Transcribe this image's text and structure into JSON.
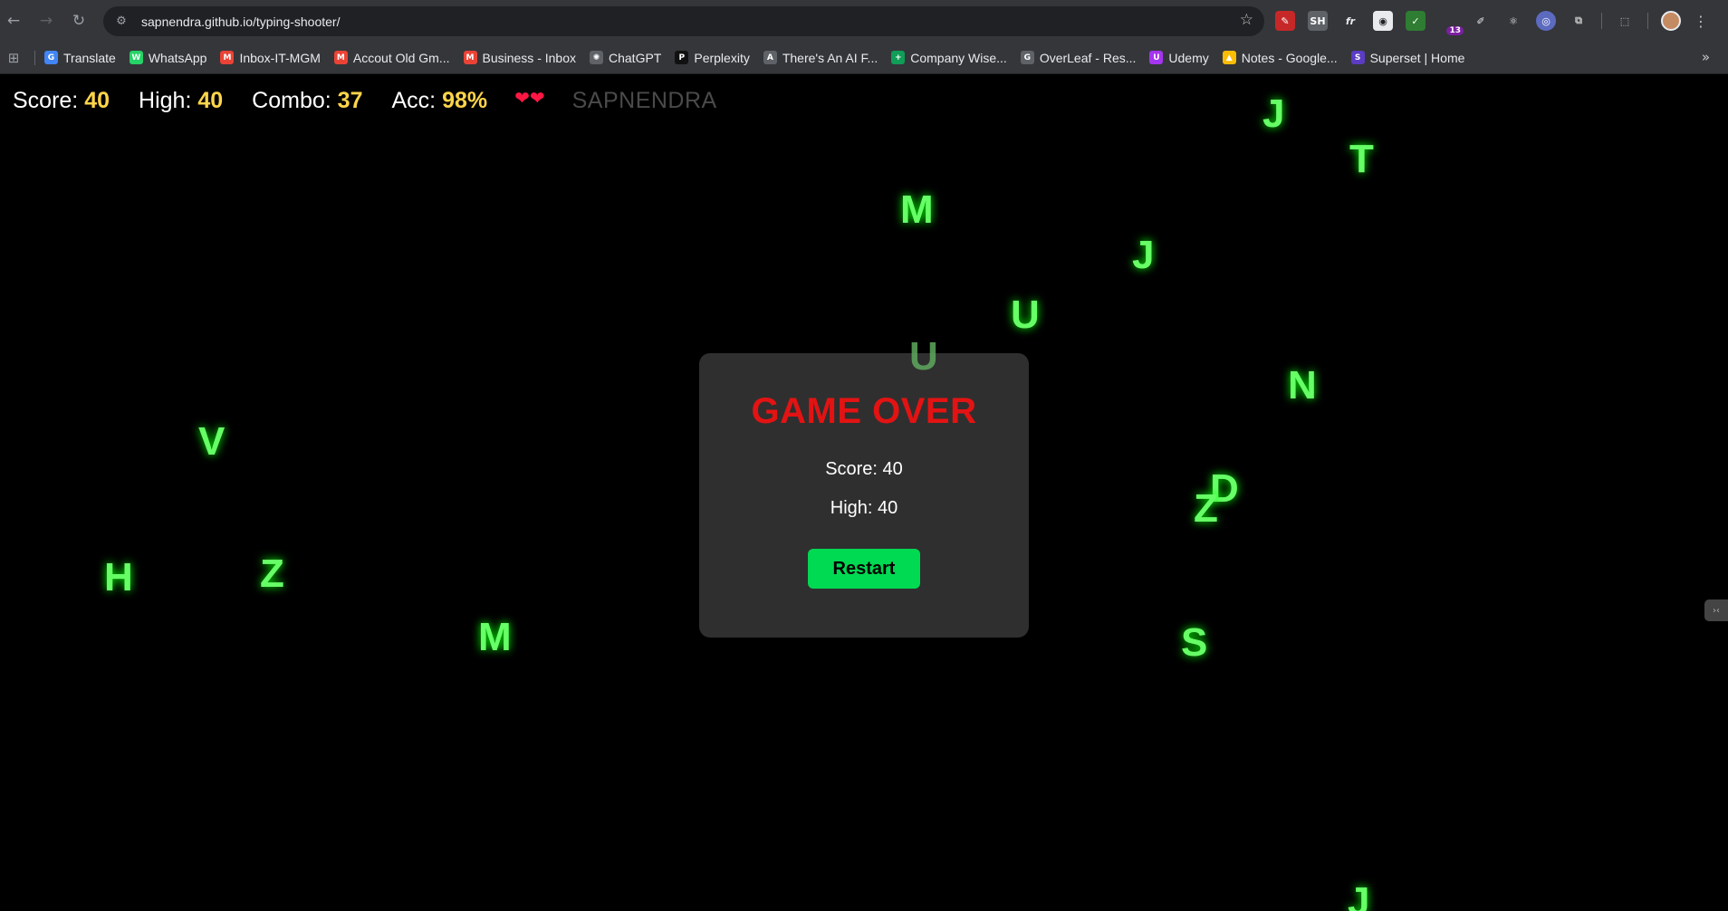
{
  "browser": {
    "url": "sapnendra.github.io/typing-shooter/",
    "extensions_badge": "13",
    "bookmarks": [
      {
        "label": "Translate",
        "color": "#4285f4",
        "glyph": "G"
      },
      {
        "label": "WhatsApp",
        "color": "#25d366",
        "glyph": "W"
      },
      {
        "label": "Inbox-IT-MGM",
        "color": "#ea4335",
        "glyph": "M"
      },
      {
        "label": "Accout Old Gm...",
        "color": "#ea4335",
        "glyph": "M"
      },
      {
        "label": "Business - Inbox",
        "color": "#ea4335",
        "glyph": "M"
      },
      {
        "label": "ChatGPT",
        "color": "#5f6368",
        "glyph": "✺"
      },
      {
        "label": "Perplexity",
        "color": "#111111",
        "glyph": "P"
      },
      {
        "label": "There's An AI F...",
        "color": "#5f6368",
        "glyph": "A"
      },
      {
        "label": "Company Wise...",
        "color": "#0f9d58",
        "glyph": "+"
      },
      {
        "label": "OverLeaf - Res...",
        "color": "#5f6368",
        "glyph": "G"
      },
      {
        "label": "Udemy",
        "color": "#a435f0",
        "glyph": "U"
      },
      {
        "label": "Notes - Google...",
        "color": "#fbbc04",
        "glyph": "▲"
      },
      {
        "label": "Superset | Home",
        "color": "#5b3cc4",
        "glyph": "S"
      }
    ]
  },
  "hud": {
    "score_label": "Score:",
    "score": "40",
    "high_label": "High:",
    "high": "40",
    "combo_label": "Combo:",
    "combo": "37",
    "acc_label": "Acc:",
    "acc": "98%",
    "lives": "❤❤",
    "player_name": "SAPNENDRA"
  },
  "letters": [
    "J",
    "T",
    "M",
    "J",
    "U",
    "U",
    "N",
    "V",
    "D",
    "Z",
    "H",
    "Z",
    "M",
    "S",
    "J"
  ],
  "game_over": {
    "title": "GAME OVER",
    "score_text": "Score: 40",
    "high_text": "High: 40",
    "restart_label": "Restart"
  },
  "colors": {
    "letter": "#66ff66",
    "title": "#e31313",
    "restart": "#00d952",
    "hud_value": "#ffd54a"
  }
}
